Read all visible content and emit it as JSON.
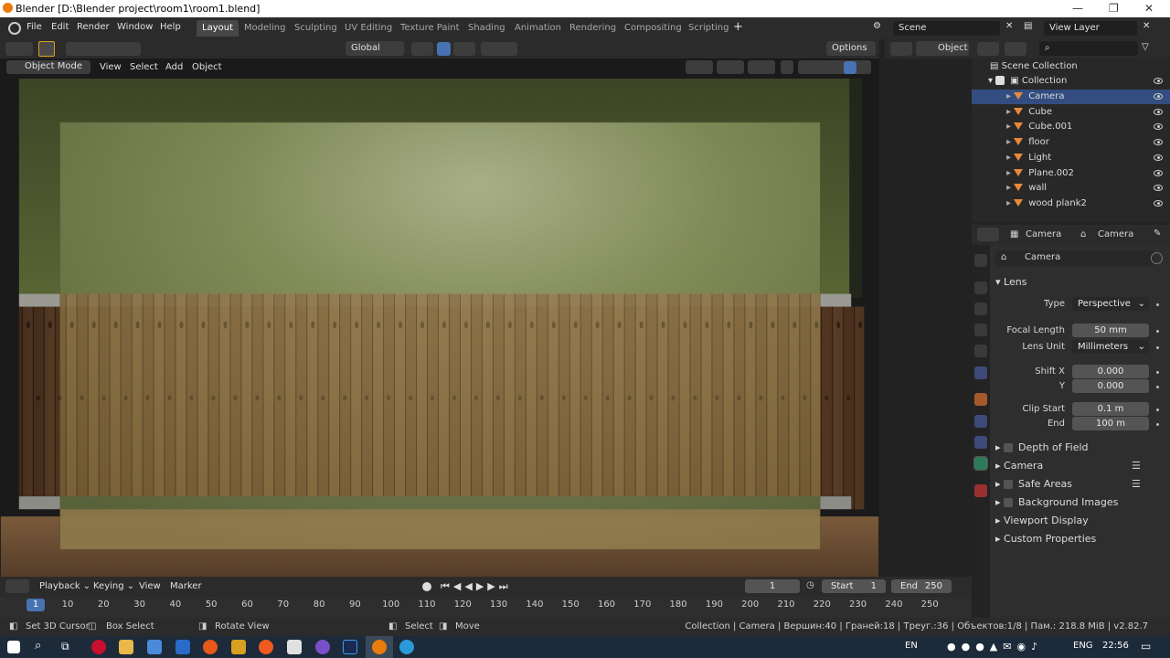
{
  "window": {
    "title": "Blender [D:\\Blender project\\room1\\room1.blend]"
  },
  "menu": [
    "File",
    "Edit",
    "Render",
    "Window",
    "Help"
  ],
  "workspaces": [
    {
      "label": "Layout",
      "active": true
    },
    {
      "label": "Modeling"
    },
    {
      "label": "Sculpting"
    },
    {
      "label": "UV Editing"
    },
    {
      "label": "Texture Paint"
    },
    {
      "label": "Shading"
    },
    {
      "label": "Animation"
    },
    {
      "label": "Rendering"
    },
    {
      "label": "Compositing"
    },
    {
      "label": "Scripting"
    }
  ],
  "scene": {
    "label": "Scene"
  },
  "view_layer": {
    "label": "View Layer"
  },
  "toolbar": {
    "orientation": "Global",
    "options": "Options",
    "object": "Object"
  },
  "viewport": {
    "mode": "Object Mode",
    "menus": [
      "View",
      "Select",
      "Add",
      "Object"
    ]
  },
  "outliner": {
    "root": "Scene Collection",
    "collection": "Collection",
    "items": [
      {
        "name": "Camera",
        "selected": true
      },
      {
        "name": "Cube"
      },
      {
        "name": "Cube.001"
      },
      {
        "name": "floor"
      },
      {
        "name": "Light"
      },
      {
        "name": "Plane.002"
      },
      {
        "name": "wall"
      },
      {
        "name": "wood plank2"
      }
    ]
  },
  "properties": {
    "breadcrumb": [
      "Camera",
      "Camera"
    ],
    "datablock": "Camera",
    "lens": {
      "section": "Lens",
      "type_label": "Type",
      "type_value": "Perspective",
      "focal_label": "Focal Length",
      "focal_value": "50 mm",
      "unit_label": "Lens Unit",
      "unit_value": "Millimeters",
      "shiftx_label": "Shift X",
      "shiftx_value": "0.000",
      "shifty_label": "Y",
      "shifty_value": "0.000",
      "clipstart_label": "Clip Start",
      "clipstart_value": "0.1 m",
      "clipend_label": "End",
      "clipend_value": "100 m"
    },
    "sections": [
      "Depth of Field",
      "Camera",
      "Safe Areas",
      "Background Images",
      "Viewport Display",
      "Custom Properties"
    ]
  },
  "timeline": {
    "menus": [
      "Playback",
      "Keying",
      "View",
      "Marker"
    ],
    "current": "1",
    "start_label": "Start",
    "start": "1",
    "end_label": "End",
    "end": "250",
    "ticks": [
      "1",
      "10",
      "20",
      "30",
      "40",
      "50",
      "60",
      "70",
      "80",
      "90",
      "100",
      "110",
      "120",
      "130",
      "140",
      "150",
      "160",
      "170",
      "180",
      "190",
      "200",
      "210",
      "220",
      "230",
      "240",
      "250"
    ]
  },
  "status": {
    "hints": [
      "Set 3D Cursor",
      "Box Select",
      "Rotate View",
      "Select",
      "Move"
    ],
    "stats": "Collection | Camera | Вершин:40 | Граней:18 | Треуг.:36 | Объектов:1/8 | Пам.: 218.8 MiB | v2.82.7"
  },
  "taskbar": {
    "lang1": "EN",
    "lang2": "ENG",
    "time": "22:56"
  },
  "colors": {
    "accent": "#4772b3",
    "selected_row": "#334d80",
    "wall": "#6f7c44",
    "wood": "#8a5a36"
  }
}
